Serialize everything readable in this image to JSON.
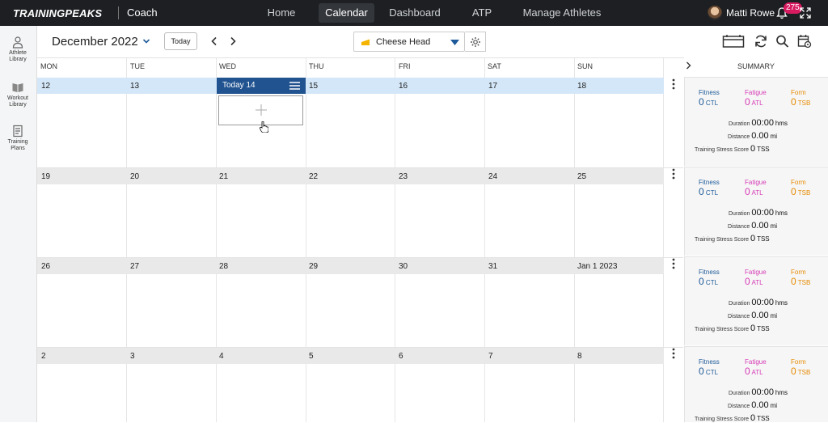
{
  "topbar": {
    "brand": "TRAININGPEAKS",
    "brand_sub": "Coach",
    "nav": [
      {
        "label": "Home"
      },
      {
        "label": "Calendar",
        "active": true
      },
      {
        "label": "Dashboard"
      },
      {
        "label": "ATP"
      },
      {
        "label": "Manage Athletes"
      }
    ],
    "user_name": "Matti Rowe",
    "notification_count": "275",
    "icons": {
      "bell": "bell-icon",
      "expand": "expand-icon"
    }
  },
  "sidebar": {
    "items": [
      {
        "label_l1": "Athlete",
        "label_l2": "Library",
        "icon": "athlete-library-icon"
      },
      {
        "label_l1": "Workout",
        "label_l2": "Library",
        "icon": "workout-library-icon"
      },
      {
        "label_l1": "Training",
        "label_l2": "Plans",
        "icon": "training-plans-icon"
      }
    ]
  },
  "toolbar": {
    "month": "December 2022",
    "today_label": "Today",
    "athlete": "Cheese Head",
    "icons": [
      "calendar-view-icon",
      "refresh-icon",
      "search-icon",
      "calendar-settings-icon"
    ]
  },
  "days": [
    "MON",
    "TUE",
    "WED",
    "THU",
    "FRI",
    "SAT",
    "SUN"
  ],
  "summary_title": "SUMMARY",
  "weeks": [
    {
      "dates": [
        "12",
        "13",
        "Today 14",
        "15",
        "16",
        "17",
        "18"
      ],
      "current": true
    },
    {
      "dates": [
        "19",
        "20",
        "21",
        "22",
        "23",
        "24",
        "25"
      ],
      "current": false
    },
    {
      "dates": [
        "26",
        "27",
        "28",
        "29",
        "30",
        "31",
        "Jan 1 2023"
      ],
      "current": false
    },
    {
      "dates": [
        "2",
        "3",
        "4",
        "5",
        "6",
        "7",
        "8"
      ],
      "current": false
    }
  ],
  "summary": {
    "fitness_label": "Fitness",
    "fatigue_label": "Fatigue",
    "form_label": "Form",
    "fitness_value": "0",
    "fatigue_value": "0",
    "form_value": "0",
    "ctl": "CTL",
    "atl": "ATL",
    "tsb": "TSB",
    "duration_label": "Duration",
    "duration_value": "00:00",
    "duration_unit": "hms",
    "distance_label": "Distance",
    "distance_value": "0.00",
    "distance_unit": "mi",
    "tss_label": "Training Stress Score",
    "tss_value": "0",
    "tss_unit": "TSS"
  },
  "colors": {
    "topbar": "#1d1f22",
    "today": "#20538f",
    "fitness": "#1d5a99",
    "fatigue": "#d63bb6",
    "form": "#e68a00"
  }
}
